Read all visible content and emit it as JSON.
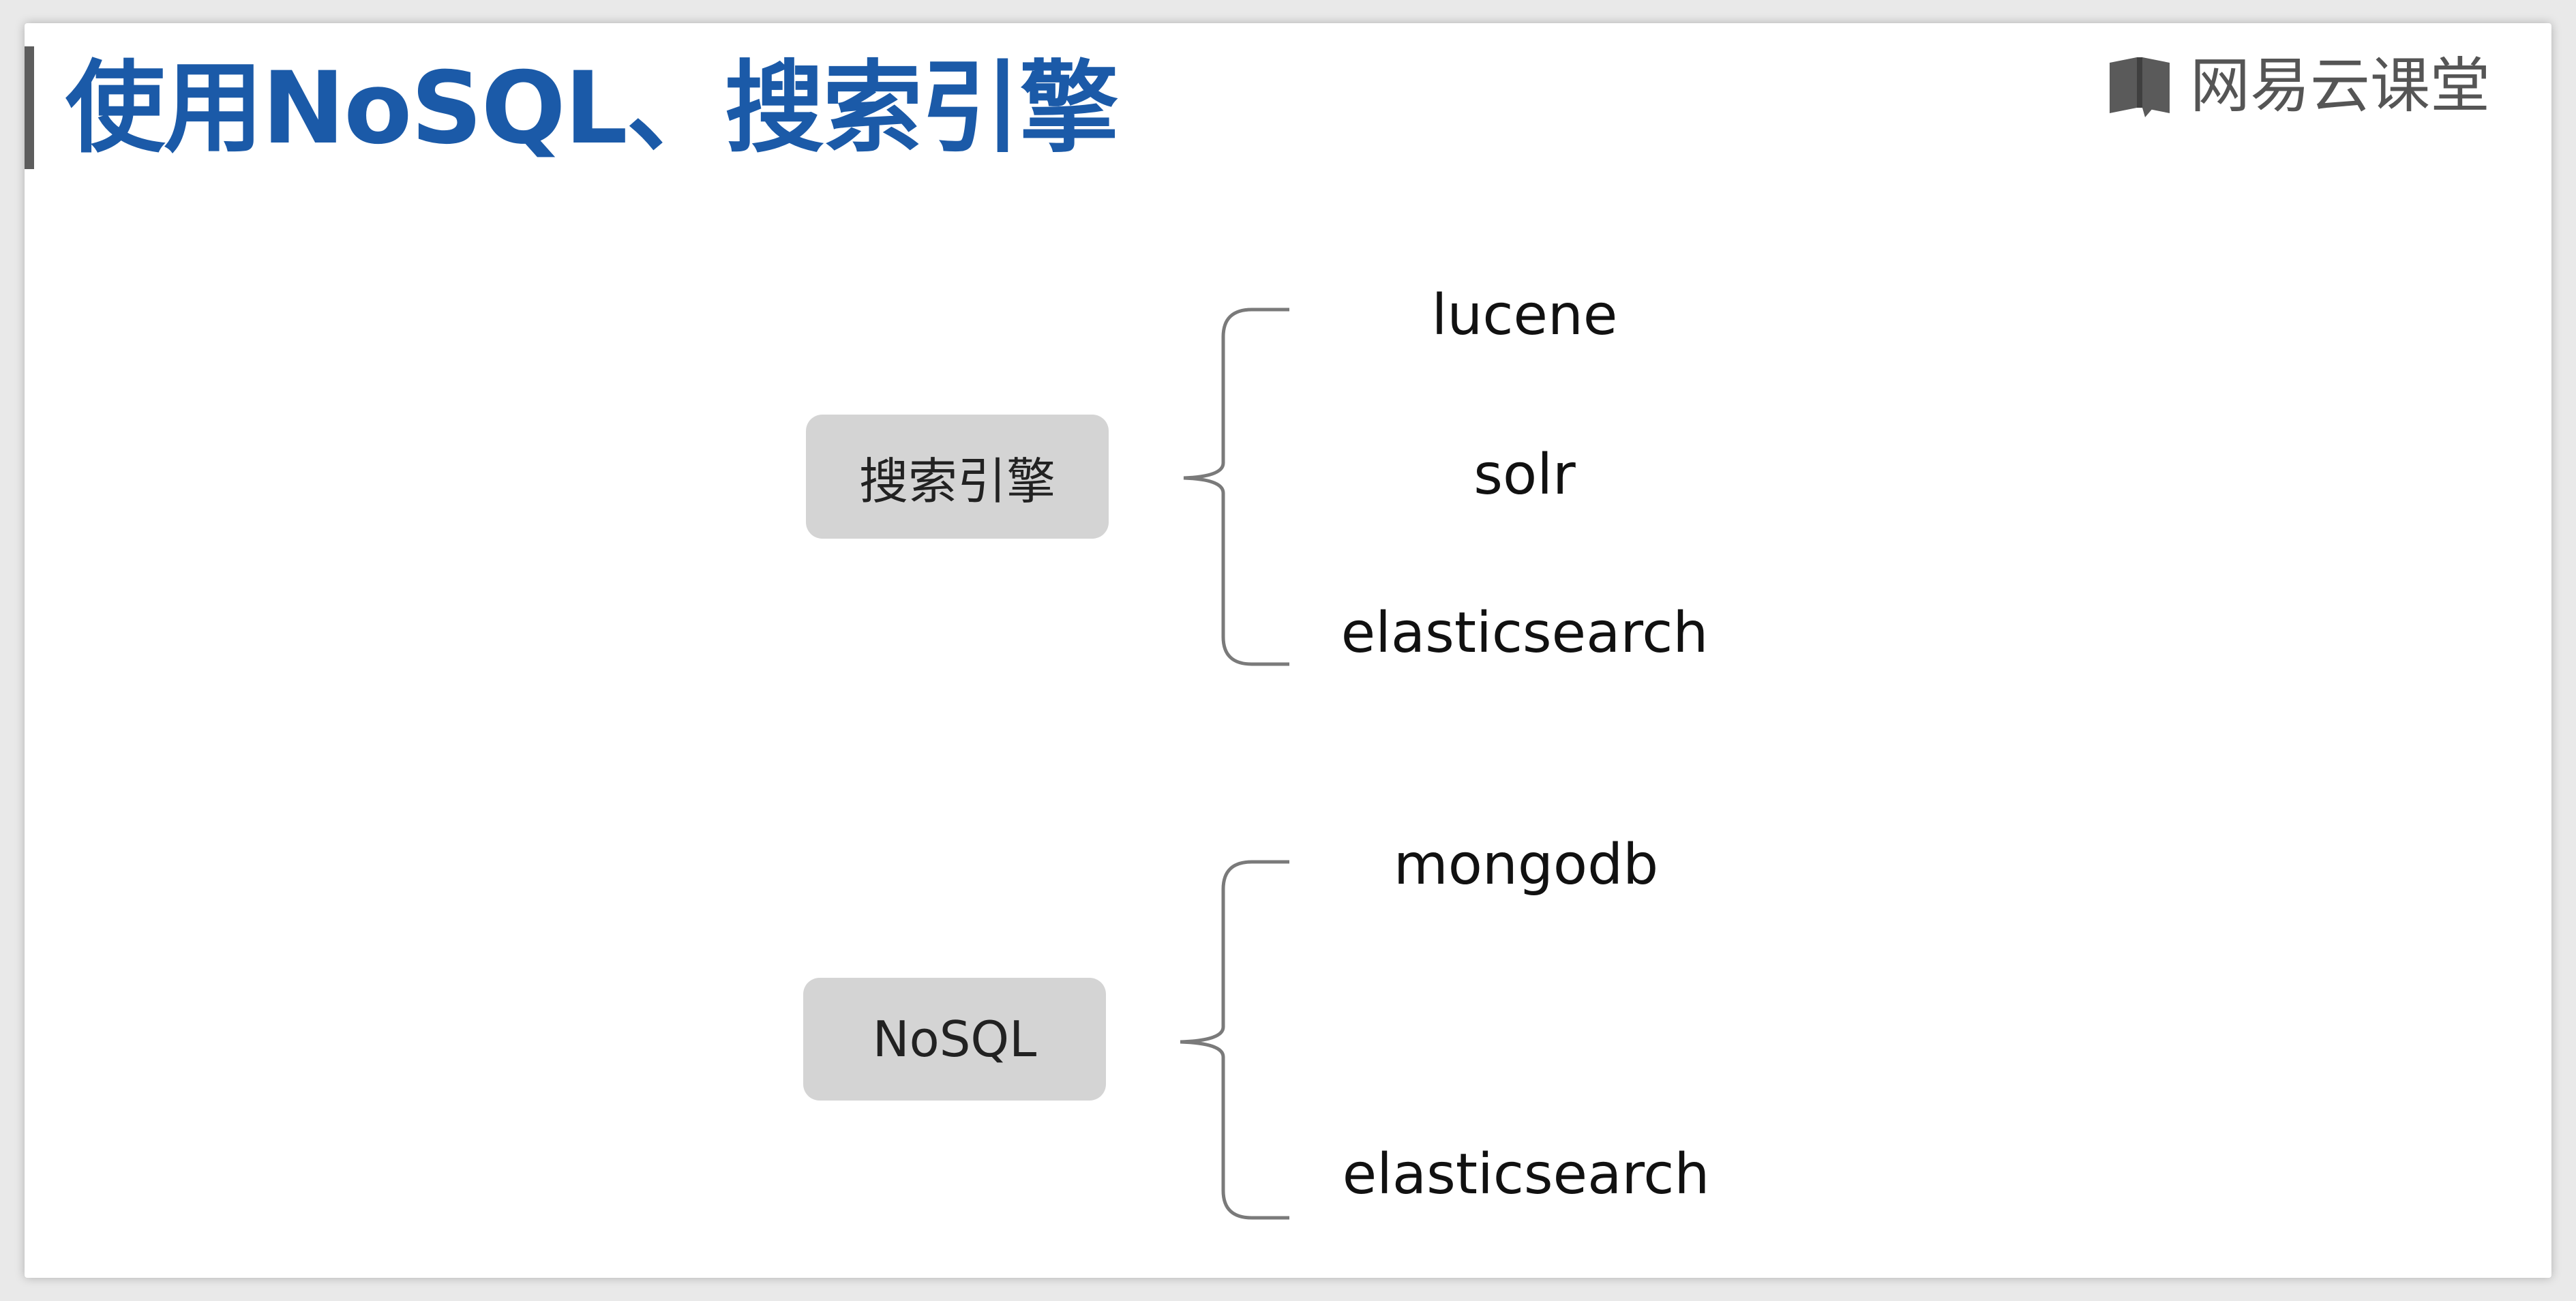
{
  "slide": {
    "title": "使用NoSQL、搜索引擎",
    "brand": "网易云课堂"
  },
  "groups": [
    {
      "label": "搜索引擎",
      "items": [
        "lucene",
        "solr",
        "elasticsearch"
      ]
    },
    {
      "label": "NoSQL",
      "items": [
        "mongodb",
        "elasticsearch"
      ]
    }
  ],
  "colors": {
    "title": "#1b5aa8",
    "node_fill": "#d4d4d4",
    "brace": "#7a7a7a",
    "accent_bar": "#5d5d5d"
  },
  "icons": {
    "brand": "book-icon"
  }
}
